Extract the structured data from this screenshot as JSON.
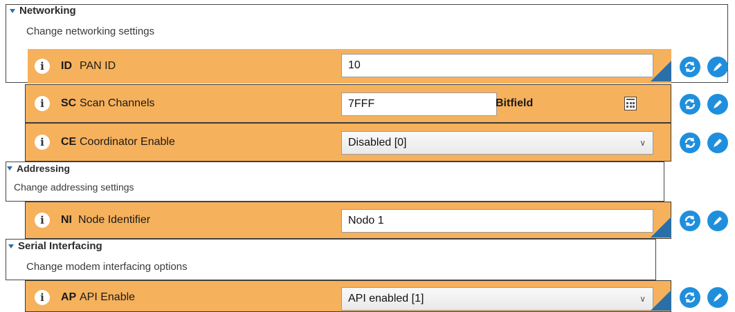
{
  "sections": {
    "networking": {
      "title": "Networking",
      "description": "Change networking settings"
    },
    "addressing": {
      "title": "Addressing",
      "description": "Change addressing settings"
    },
    "serial": {
      "title": "Serial Interfacing",
      "description": "Change modem interfacing options"
    }
  },
  "settings": {
    "id": {
      "code": "ID",
      "label": "PAN ID",
      "value": "10"
    },
    "sc": {
      "code": "SC",
      "label": "Scan Channels",
      "value": "7FFF",
      "suffix": "Bitfield"
    },
    "ce": {
      "code": "CE",
      "label": "Coordinator Enable",
      "value": "Disabled [0]"
    },
    "ni": {
      "code": "NI",
      "label": "Node Identifier",
      "value": "Nodo 1"
    },
    "ap": {
      "code": "AP",
      "label": "API Enable",
      "value": "API enabled [1]"
    }
  },
  "icons": {
    "info": "info-icon",
    "reset": "refresh-icon",
    "write": "pencil-icon",
    "calculator": "calculator-icon",
    "modified": "modified-corner-icon"
  },
  "colors": {
    "row": "#f6b15c",
    "accent": "#1f8fdd",
    "modified": "#2a6fa8"
  }
}
